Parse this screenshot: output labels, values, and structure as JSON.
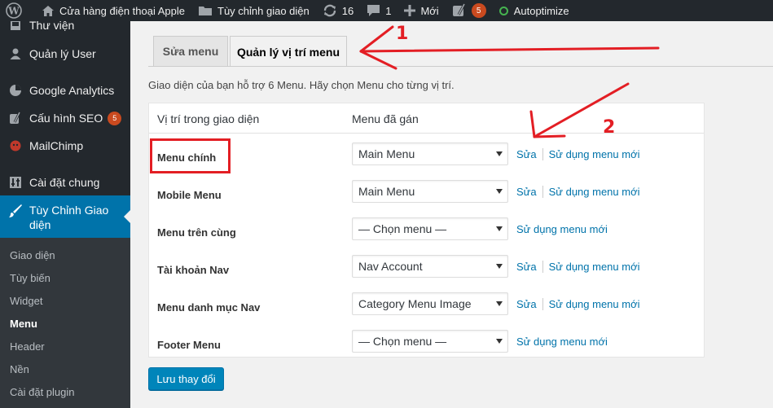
{
  "adminbar": {
    "site_name": "Cửa hàng điện thoại Apple",
    "customize": "Tùy chỉnh giao diện",
    "updates_count": "16",
    "comments_count": "1",
    "new_label": "Mới",
    "yoast_count": "5",
    "autoptimize": "Autoptimize"
  },
  "sidebar": {
    "top_items": [
      {
        "label": "Thư viện",
        "icon": "media-icon"
      },
      {
        "label": "Quản lý User",
        "icon": "user-icon"
      },
      {
        "label": "Google Analytics",
        "icon": "analytics-icon"
      },
      {
        "label": "Cấu hình SEO",
        "icon": "yoast-icon",
        "badge": "5"
      },
      {
        "label": "MailChimp",
        "icon": "mailchimp-icon"
      },
      {
        "label": "Cài đặt chung",
        "icon": "settings-icon"
      }
    ],
    "active_item": {
      "label": "Tùy Chỉnh Giao diện",
      "icon": "brush-icon"
    },
    "submenu": [
      {
        "label": "Giao diện",
        "current": false
      },
      {
        "label": "Tùy biến",
        "current": false
      },
      {
        "label": "Widget",
        "current": false
      },
      {
        "label": "Menu",
        "current": true
      },
      {
        "label": "Header",
        "current": false
      },
      {
        "label": "Nền",
        "current": false
      },
      {
        "label": "Cài đặt plugin",
        "current": false
      }
    ]
  },
  "tabs": [
    {
      "label": "Sửa menu",
      "active": false
    },
    {
      "label": "Quản lý vị trí menu",
      "active": true
    }
  ],
  "intro": "Giao diện của bạn hỗ trợ 6 Menu. Hãy chọn Menu cho từng vị trí.",
  "table": {
    "headers": [
      "Vị trí trong giao diện",
      "Menu đã gán"
    ],
    "rows": [
      {
        "location": "Menu chính",
        "selected": "Main Menu",
        "edit": "Sửa",
        "use_new": "Sử dụng menu mới"
      },
      {
        "location": "Mobile Menu",
        "selected": "Main Menu",
        "edit": "Sửa",
        "use_new": "Sử dụng menu mới"
      },
      {
        "location": "Menu trên cùng",
        "selected": "— Chọn menu —",
        "edit": "",
        "use_new": "Sử dụng menu mới"
      },
      {
        "location": "Tài khoản Nav",
        "selected": "Nav Account",
        "edit": "Sửa",
        "use_new": "Sử dụng menu mới"
      },
      {
        "location": "Menu danh mục Nav",
        "selected": "Category Menu Image",
        "edit": "Sửa",
        "use_new": "Sử dụng menu mới"
      },
      {
        "location": "Footer Menu",
        "selected": "— Chọn menu —",
        "edit": "",
        "use_new": "Sử dụng menu mới"
      }
    ]
  },
  "save_button": "Lưu thay đổi",
  "annotations": {
    "label_1": "1",
    "label_2": "2",
    "color": "#e31e24"
  },
  "colors": {
    "adminbar": "#23282d",
    "accent": "#0073aa",
    "primary_button": "#0085ba",
    "badge": "#ca4a1f"
  }
}
